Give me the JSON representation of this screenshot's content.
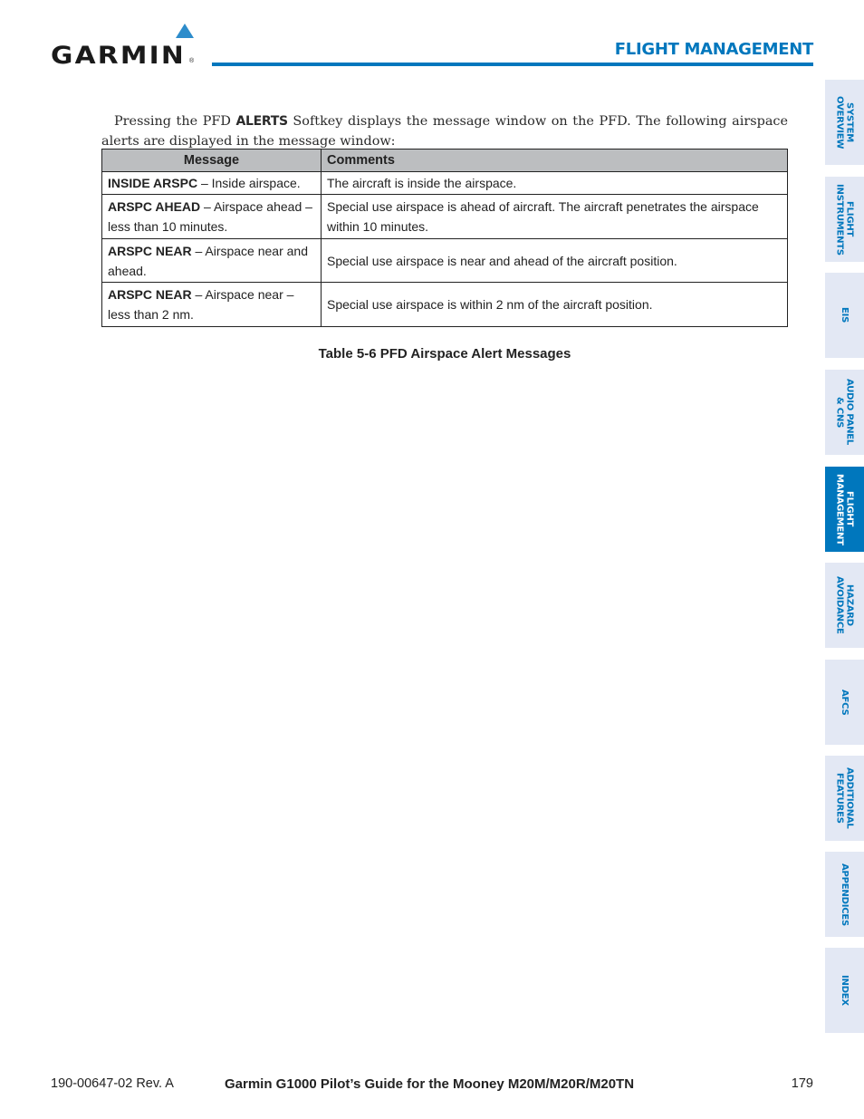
{
  "header": {
    "logo_text": "GARMIN",
    "logo_reg": "®",
    "section_title": "FLIGHT MANAGEMENT",
    "brand_color": "#0077bd"
  },
  "intro": {
    "before": "Pressing the PFD ",
    "softkey": "ALERTS",
    "after": " Softkey displays the message window on the PFD. The following airspace alerts are displayed in the message window:"
  },
  "table": {
    "headers": [
      "Message",
      "Comments"
    ],
    "rows": [
      {
        "code": "INSIDE ARSPC",
        "desc": " – Inside airspace.",
        "comment": "The aircraft is inside the airspace."
      },
      {
        "code": "ARSPC AHEAD",
        "desc": " – Airspace ahead – less than 10 minutes.",
        "comment": "Special use airspace is ahead of aircraft.  The aircraft penetrates the airspace within 10 minutes."
      },
      {
        "code": "ARSPC NEAR",
        "desc": " – Airspace near and ahead.",
        "comment": "Special use airspace is near and ahead of the aircraft position."
      },
      {
        "code": "ARSPC NEAR",
        "desc": " – Airspace near – less than 2 nm.",
        "comment": "Special use airspace is within 2 nm of the aircraft position."
      }
    ],
    "caption": "Table 5-6  PFD Airspace Alert Messages"
  },
  "side_tabs": [
    {
      "label": "SYSTEM\nOVERVIEW",
      "active": false
    },
    {
      "label": "FLIGHT\nINSTRUMENTS",
      "active": false
    },
    {
      "label": "EIS",
      "active": false
    },
    {
      "label": "AUDIO PANEL\n& CNS",
      "active": false
    },
    {
      "label": "FLIGHT\nMANAGEMENT",
      "active": true
    },
    {
      "label": "HAZARD\nAVOIDANCE",
      "active": false
    },
    {
      "label": "AFCS",
      "active": false
    },
    {
      "label": "ADDITIONAL\nFEATURES",
      "active": false
    },
    {
      "label": "APPENDICES",
      "active": false
    },
    {
      "label": "INDEX",
      "active": false
    }
  ],
  "footer": {
    "doc_number": "190-00647-02  Rev. A",
    "title": "Garmin G1000 Pilot’s Guide for the Mooney M20M/M20R/M20TN",
    "page_number": "179"
  }
}
